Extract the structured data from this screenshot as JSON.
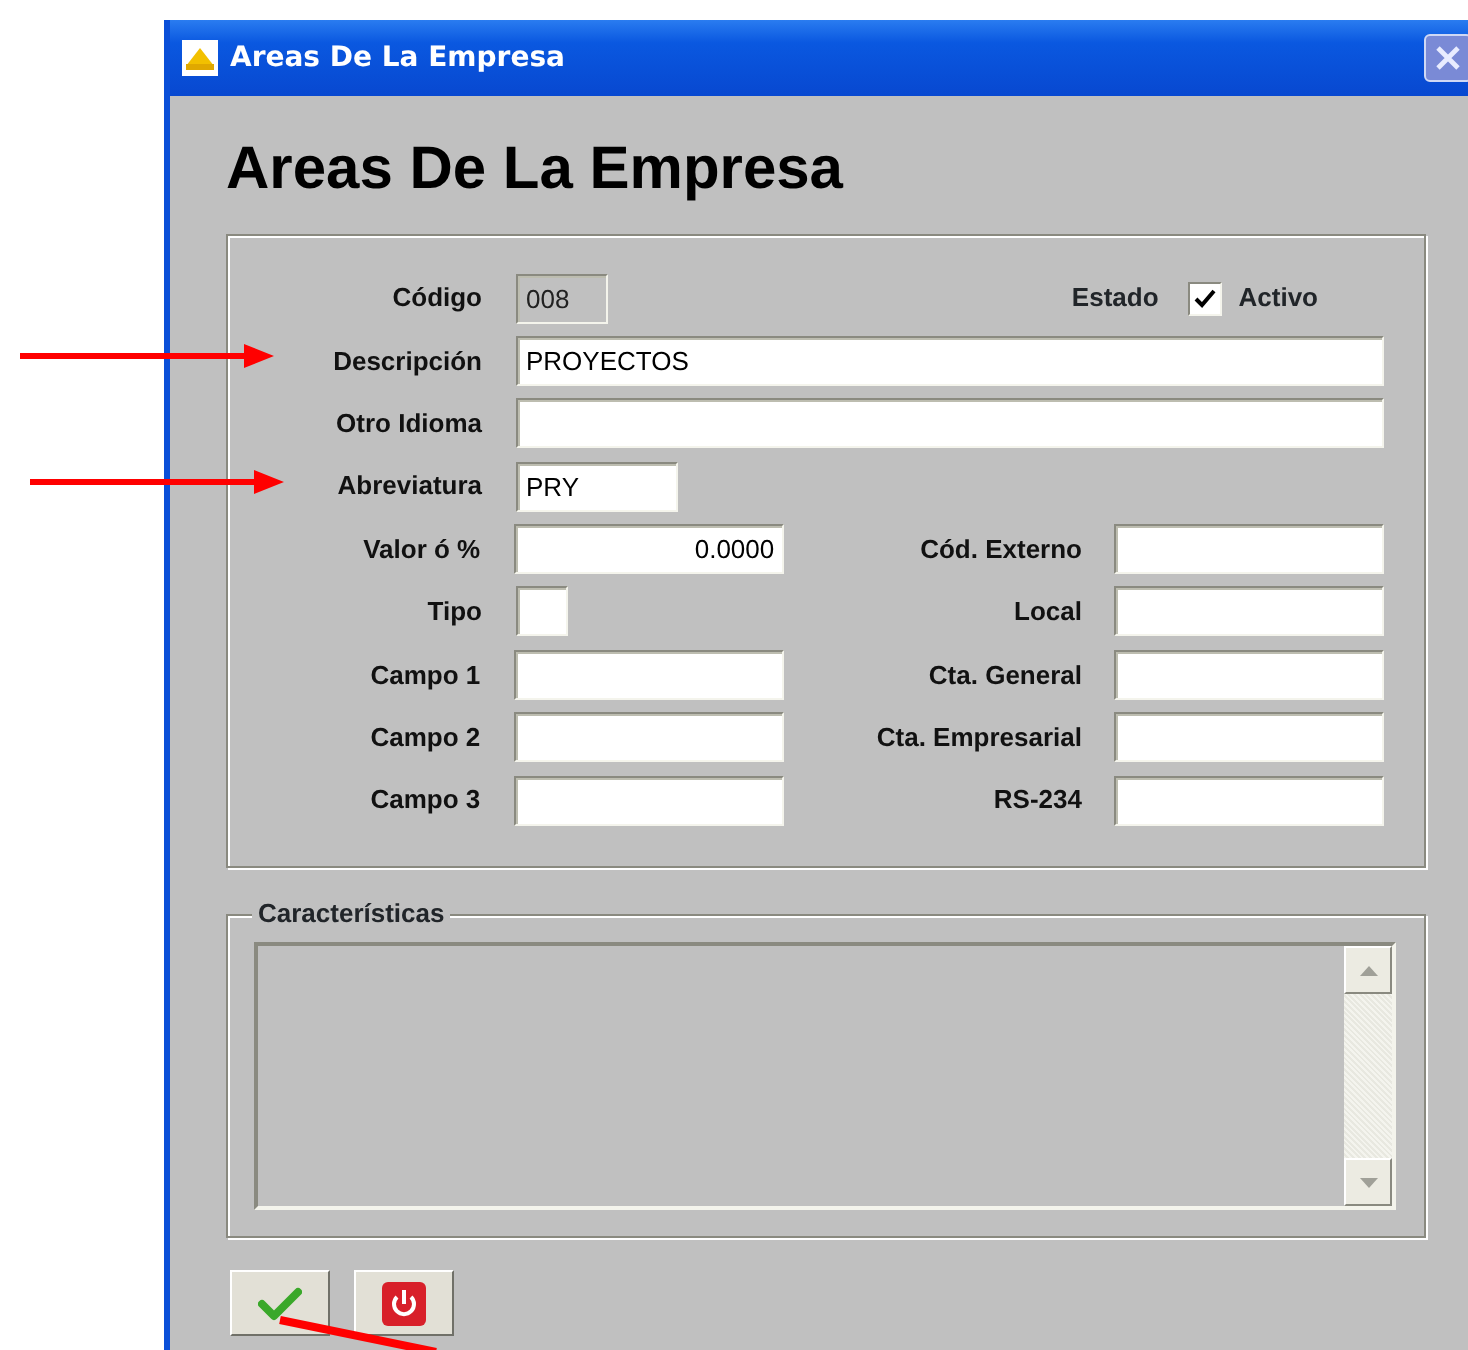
{
  "window": {
    "title": "Areas De La Empresa"
  },
  "heading": "Areas De La Empresa",
  "form": {
    "rows": [
      {
        "label": "Código",
        "field": {
          "kind": "code",
          "value": "008",
          "disabled": true
        },
        "right": {
          "kind": "checkbox",
          "label": "Estado",
          "option": "Activo",
          "checked": true
        }
      },
      {
        "label": "Descripción",
        "field": {
          "kind": "wide",
          "value": "PROYECTOS",
          "disabled": false
        }
      },
      {
        "label": "Otro Idioma",
        "field": {
          "kind": "wide",
          "disabled": false
        }
      },
      {
        "label": "Abreviatura",
        "field": {
          "kind": "short",
          "value": "PRY",
          "disabled": false
        }
      },
      {
        "label": "Valor ó %",
        "field": {
          "kind": "number",
          "value": "0.0000",
          "disabled": false
        },
        "right": {
          "kind": "field",
          "label": "Cód. Externo"
        }
      },
      {
        "label": "Tipo",
        "field": {
          "kind": "char",
          "disabled": false
        },
        "right": {
          "kind": "field",
          "label": "Local"
        }
      },
      {
        "label": "Campo 1",
        "field": {
          "kind": "text",
          "disabled": false
        },
        "right": {
          "kind": "field",
          "label": "Cta. General"
        }
      },
      {
        "label": "Campo 2",
        "field": {
          "kind": "text",
          "disabled": false
        },
        "right": {
          "kind": "field",
          "label": "Cta. Empresarial"
        }
      },
      {
        "label": "Campo 3",
        "field": {
          "kind": "text",
          "disabled": false
        },
        "right": {
          "kind": "field",
          "label": "RS-234"
        }
      }
    ]
  },
  "characteristics": {
    "legend": "Características"
  },
  "buttons": [
    {
      "kind": "accept"
    },
    {
      "kind": "exit"
    }
  ]
}
